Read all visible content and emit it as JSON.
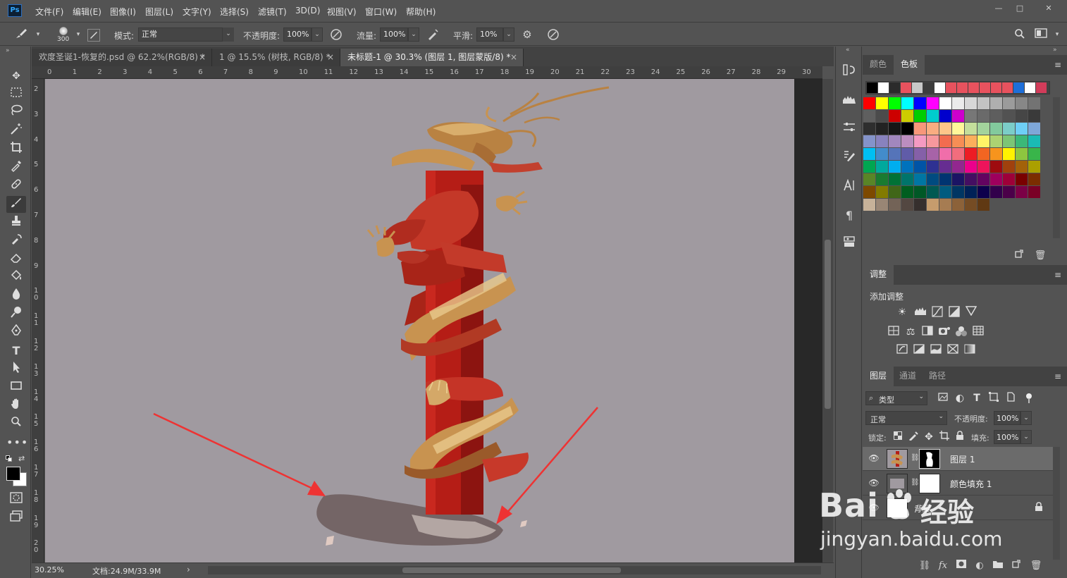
{
  "app": {
    "logo": "Ps"
  },
  "menu": [
    "文件(F)",
    "编辑(E)",
    "图像(I)",
    "图层(L)",
    "文字(Y)",
    "选择(S)",
    "滤镜(T)",
    "3D(D)",
    "视图(V)",
    "窗口(W)",
    "帮助(H)"
  ],
  "window_controls": [
    "—",
    "□",
    "✕"
  ],
  "options": {
    "brush_size": "300",
    "mode_label": "模式:",
    "mode_value": "正常",
    "opacity_label": "不透明度:",
    "opacity_value": "100%",
    "flow_label": "流量:",
    "flow_value": "100%",
    "smooth_label": "平滑:",
    "smooth_value": "10%"
  },
  "tabs": [
    {
      "label": "欢度圣诞1-恢复的.psd @ 62.2%(RGB/8) *",
      "active": false
    },
    {
      "label": "1 @ 15.5% (树枝, RGB/8) *",
      "active": false
    },
    {
      "label": "未标题-1 @ 30.3% (图层 1, 图层蒙版/8) *",
      "active": true
    }
  ],
  "tab_close": "×",
  "ruler_h": [
    "0",
    "1",
    "2",
    "3",
    "4",
    "5",
    "6",
    "7",
    "8",
    "9",
    "10",
    "11",
    "12",
    "13",
    "14",
    "15",
    "16",
    "17",
    "18",
    "19",
    "20",
    "21",
    "22",
    "23",
    "24",
    "25",
    "26",
    "27",
    "28",
    "29",
    "30"
  ],
  "ruler_v": [
    "2",
    "3",
    "4",
    "5",
    "6",
    "7",
    "8",
    "9",
    "1 0",
    "1 1",
    "1 2",
    "1 3",
    "1 4",
    "1 5",
    "1 6",
    "1 7",
    "1 8",
    "1 9",
    "2 0"
  ],
  "status": {
    "zoom": "30.25%",
    "doc_info": "文档:24.9M/33.9M",
    "arrow": "›"
  },
  "swatches_panel": {
    "tabs": [
      "颜色",
      "色板"
    ],
    "active_tab": "色板",
    "recent": [
      "#000000",
      "#ffffff",
      "#2b2b2b",
      "#e8525e",
      "#c8c8c8",
      "#3c3c3c",
      "#ffffff",
      "#e8525e",
      "#e8525e",
      "#e8525e",
      "#e8525e",
      "#e8525e",
      "#e8525e",
      "#1e6fd9",
      "#ffffff",
      "#d23c5a"
    ],
    "rows": [
      [
        "#ff0000",
        "#ffff00",
        "#00ff00",
        "#00ffff",
        "#0000ff",
        "#ff00ff",
        "#ffffff",
        "#ebebeb",
        "#d7d7d7",
        "#c3c3c3",
        "#afafaf",
        "#9b9b9b",
        "#878787",
        "#737373"
      ],
      [
        "#5f5f5f",
        "#4b4b4b",
        "#cd0000",
        "#cdcd00",
        "#00cd00",
        "#00cdcd",
        "#0000cd",
        "#cd00cd",
        "#777777",
        "#6a6a6a",
        "#5e5e5e",
        "#525252",
        "#464646",
        "#3a3a3a"
      ],
      [
        "#2e2e2e",
        "#222222",
        "#161616",
        "#000000",
        "#f7977a",
        "#f9ad81",
        "#fdc68a",
        "#fff79a",
        "#c4df9b",
        "#a3d39c",
        "#82ca9d",
        "#7bcdc8",
        "#6ecff6",
        "#7ea7d8"
      ],
      [
        "#8493ca",
        "#8882be",
        "#a187be",
        "#bc8dbf",
        "#f49ac2",
        "#f6989d",
        "#f26c4f",
        "#f68e55",
        "#fbaf5c",
        "#fff467",
        "#acd372",
        "#7cc576",
        "#3bb878",
        "#1abbb4"
      ],
      [
        "#00bff3",
        "#438ccb",
        "#5574b9",
        "#605ca8",
        "#8560a8",
        "#a763a8",
        "#f06eaa",
        "#f26d7d",
        "#ed1c24",
        "#f26522",
        "#f7941d",
        "#fff200",
        "#8dc63f",
        "#39b54a"
      ],
      [
        "#00a651",
        "#00a99d",
        "#00aeef",
        "#0072bc",
        "#0054a6",
        "#2e3192",
        "#662d91",
        "#92278f",
        "#ec008c",
        "#ed145b",
        "#9e0b0f",
        "#a0410d",
        "#a36209",
        "#aba000"
      ],
      [
        "#598527",
        "#1a7b30",
        "#007236",
        "#00746b",
        "#0076a3",
        "#004b80",
        "#003471",
        "#1b1464",
        "#440e62",
        "#630460",
        "#9e005d",
        "#9e0039",
        "#790000",
        "#7b2e00"
      ],
      [
        "#7d4900",
        "#827b00",
        "#406618",
        "#005e20",
        "#005826",
        "#005952",
        "#005b7f",
        "#003663",
        "#002157",
        "#0d004c",
        "#32004b",
        "#4b0049",
        "#7b0046",
        "#7a0026"
      ],
      [
        "#c7b299",
        "#998675",
        "#736357",
        "#534741",
        "#362f2d",
        "#c69c6d",
        "#a67c52",
        "#8c6239",
        "#754c24",
        "#603913"
      ]
    ]
  },
  "adjustments_panel": {
    "tab": "调整",
    "title": "添加调整",
    "icons_row1": [
      "brightness-icon",
      "levels-icon",
      "curves-icon",
      "exposure-icon",
      "vibrance-icon"
    ],
    "icons_row2": [
      "hsl-icon",
      "color-balance-icon",
      "black-white-icon",
      "photo-filter-icon",
      "channel-mixer-icon",
      "color-lookup-icon"
    ],
    "icons_row3": [
      "invert-icon",
      "posterize-icon",
      "threshold-icon",
      "selective-color-icon",
      "gradient-map-icon"
    ]
  },
  "layers_panel": {
    "tabs": [
      "图层",
      "通道",
      "路径"
    ],
    "active_tab": "图层",
    "filter_label": "类型",
    "blend_mode": "正常",
    "opacity_label": "不透明度:",
    "opacity_value": "100%",
    "lock_label": "锁定:",
    "fill_label": "填充:",
    "fill_value": "100%",
    "layers": [
      {
        "name": "图层 1",
        "selected": true
      },
      {
        "name": "颜色填充 1",
        "selected": false
      },
      {
        "name": "背景",
        "selected": false
      }
    ]
  },
  "watermark": {
    "brand": "Bai",
    "brand2": "经验",
    "url": "jingyan.baidu.com"
  },
  "colors": {
    "canvas_bg": "#a09aa0",
    "pillar": "#b01e15",
    "dragon_gold": "#c89a55",
    "arrow": "#ee3333"
  }
}
